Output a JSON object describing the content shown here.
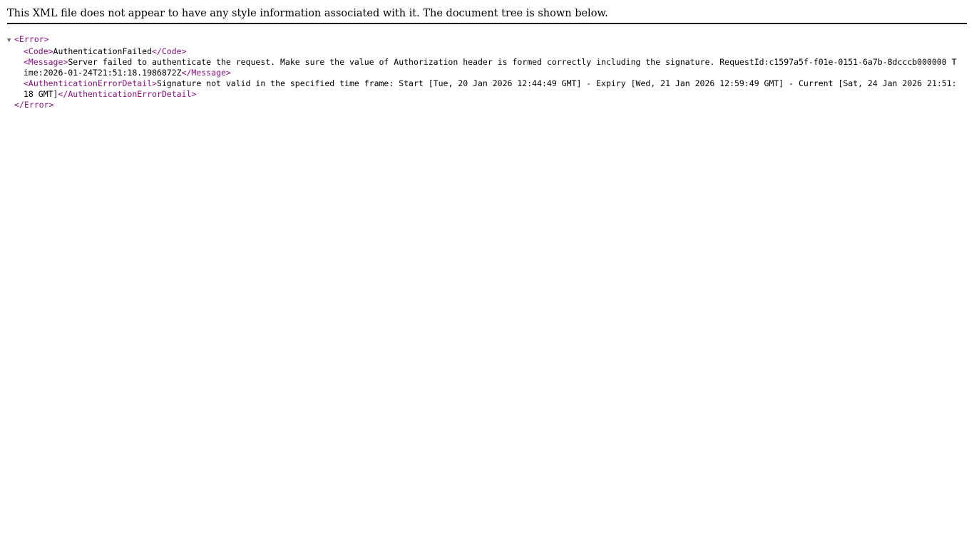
{
  "header": {
    "notice": "This XML file does not appear to have any style information associated with it. The document tree is shown below."
  },
  "xml": {
    "root_open": "<Error>",
    "root_close": "</Error>",
    "code": {
      "open": "<Code>",
      "text": "AuthenticationFailed",
      "close": "</Code>"
    },
    "message": {
      "open": "<Message>",
      "text": "Server failed to authenticate the request. Make sure the value of Authorization header is formed correctly including the signature. RequestId:c1597a5f-f01e-0151-6a7b-8dcccb000000 Time:2026-01-24T21:51:18.1986872Z",
      "close": "</Message>"
    },
    "detail": {
      "open": "<AuthenticationErrorDetail>",
      "text": "Signature not valid in the specified time frame: Start [Tue, 20 Jan 2026 12:44:49 GMT] - Expiry [Wed, 21 Jan 2026 12:59:49 GMT] - Current [Sat, 24 Jan 2026 21:51:18 GMT]",
      "close": "</AuthenticationErrorDetail>"
    }
  },
  "colors": {
    "tag": "#881280",
    "text": "#000000",
    "toggle": "#6e6e6e"
  }
}
